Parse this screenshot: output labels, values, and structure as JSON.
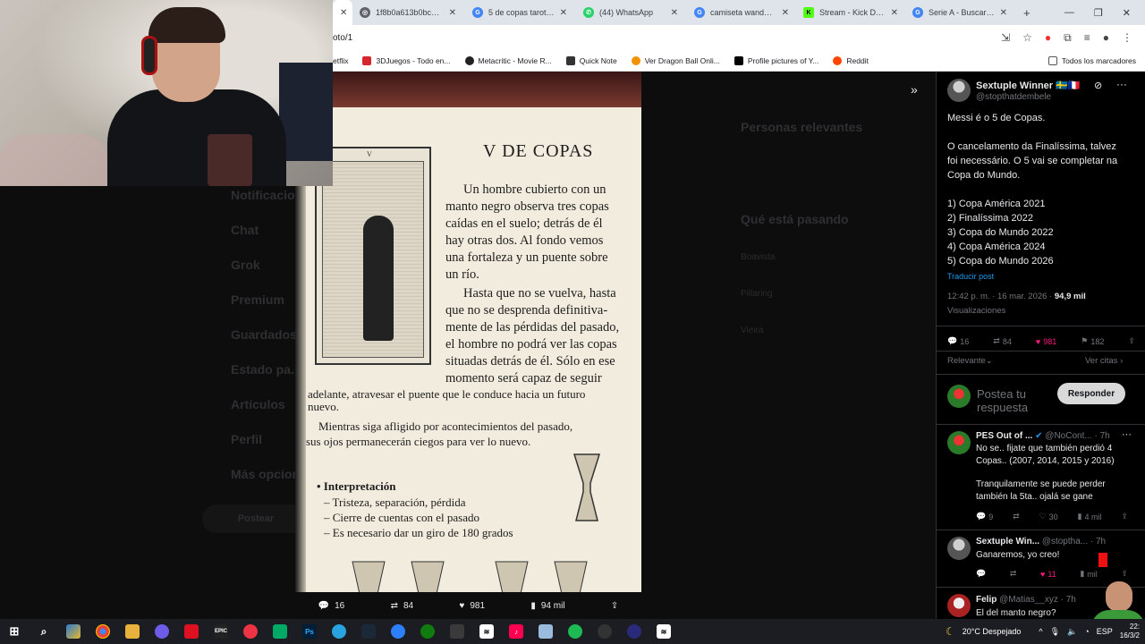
{
  "browser": {
    "tabs": [
      {
        "label": "",
        "active": true
      },
      {
        "label": "1f8b0a613b0bc488e...",
        "icon": "globe-icon",
        "color": "#5f6368"
      },
      {
        "label": "5 de copas tarot - Bu...",
        "icon": "google-icon",
        "color": "#4285f4"
      },
      {
        "label": "(44) WhatsApp",
        "icon": "whatsapp-icon",
        "color": "#25d366"
      },
      {
        "label": "camiseta wanderers c...",
        "icon": "google-icon",
        "color": "#4285f4"
      },
      {
        "label": "Stream - Kick Dashbo...",
        "icon": "kick-icon",
        "color": "#53fc18"
      },
      {
        "label": "Serie A - Buscar con...",
        "icon": "google-icon",
        "color": "#4285f4"
      }
    ],
    "new_tab": "+",
    "address": "oto/1",
    "bookmarks": [
      {
        "label": "etflix",
        "color": "#ffffff"
      },
      {
        "label": "3DJuegos - Todo en...",
        "color": "#d6262f"
      },
      {
        "label": "Metacritic - Movie R...",
        "color": "#222222"
      },
      {
        "label": "Quick Note",
        "color": "#333333"
      },
      {
        "label": "Ver Dragon Ball Onli...",
        "color": "#f39200"
      },
      {
        "label": "Profile pictures of Y...",
        "color": "#000000"
      },
      {
        "label": "Reddit",
        "color": "#ff4500"
      }
    ],
    "all_bookmarks": "Todos los marcadores"
  },
  "background_nav": [
    "Notificaciones",
    "Chat",
    "Grok",
    "Premium",
    "Guardados",
    "Estado pa...",
    "Artículos",
    "Perfil",
    "Más opcion..."
  ],
  "background_nav_button": "Postear",
  "background_right": {
    "relevant_title": "Personas relevantes",
    "happening_title": "Qué está pasando",
    "trends": [
      "Boavista",
      "Pillaring",
      "Vieira"
    ]
  },
  "photo": {
    "book_title": "V DE COPAS",
    "card_label": "V",
    "paragraph_lines": [
      "Un hombre cubierto con un",
      "manto negro observa tres copas",
      "caídas en el suelo; detrás de él",
      "hay otras dos. Al fondo vemos",
      "una fortaleza y un puente sobre",
      "un río.",
      "Hasta que no se vuelva, hasta",
      "que no se desprenda definitiva-",
      "mente de las pérdidas del pasado,",
      "el hombre no podrá ver las copas",
      "situadas detrás de él. Sólo en ese",
      "momento será capaz de seguir"
    ],
    "full_lines": [
      "adelante, atravesar el puente que le conduce hacia un futuro",
      "nuevo.",
      "Mientras siga afligido por acontecimientos del pasado,",
      "sus ojos permanecerán ciegos para ver lo nuevo."
    ],
    "interp_title": "• Interpretación",
    "interp_items": [
      "– Tristeza, separación, pérdida",
      "– Cierre de cuentas con el pasado",
      "– Es necesario dar un giro de 180 grados"
    ]
  },
  "photo_bar": {
    "replies": "16",
    "reposts": "84",
    "likes": "981",
    "views": "94 mil"
  },
  "tweet": {
    "author": "Sextuple Winner 🇸🇪🇫🇷",
    "handle": "@stopthatdembele",
    "lines": [
      "Messi é o 5 de Copas.",
      "O cancelamento da Finalíssima, talvez",
      "foi necessário. O 5 vai se completar na",
      "Copa do Mundo.",
      "1) Copa América 2021",
      "2) Finalíssima 2022",
      "3) Copa do Mundo 2022",
      "4) Copa América 2024",
      "5) Copa do Mundo 2026"
    ],
    "translate": "Traducir post",
    "time": "12:42 p. m. · 16 mar. 2026 · ",
    "views_count": "94,9 mil",
    "views_label": "Visualizaciones",
    "replies": "16",
    "reposts": "84",
    "likes": "981",
    "bookmarks": "182",
    "sort": "Relevante",
    "quotes": "Ver citas"
  },
  "compose": {
    "placeholder_line1": "Postea tu",
    "placeholder_line2": "respuesta",
    "reply_button": "Responder"
  },
  "replies": [
    {
      "author": "PES Out of ...",
      "handle": "@NoCont...",
      "time": "· 7h",
      "lines": [
        "No se.. fijate que también perdió 4",
        "Copas.. (2007, 2014, 2015 y 2016)",
        "",
        "Tranquilamente se puede perder",
        "también la 5ta.. ojalá se gane"
      ],
      "replies": "9",
      "reposts": "",
      "likes": "30",
      "views": "4 mil"
    },
    {
      "author": "Sextuple Win...",
      "handle": "@stoptha...",
      "time": "· 7h",
      "lines": [
        "Ganaremos, yo creo!"
      ],
      "replies": "",
      "reposts": "",
      "likes": "11",
      "views": "mil"
    },
    {
      "author": "Felip",
      "handle": "@Matias__xyz",
      "time": "· 7h",
      "lines": [
        "El del manto negro?"
      ]
    }
  ],
  "taskbar": {
    "weather": "20°C  Despejado",
    "lang": "ESP",
    "time": "22:",
    "date": "16/3/2"
  }
}
